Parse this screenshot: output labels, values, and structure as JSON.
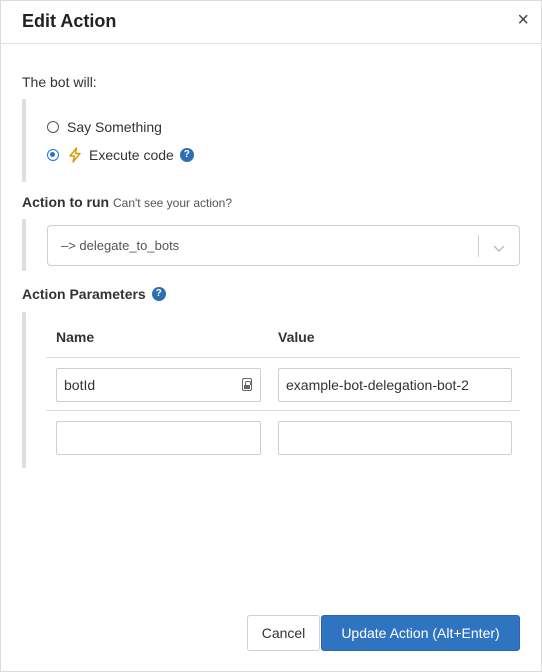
{
  "dialog": {
    "title": "Edit Action",
    "close_glyph": "×"
  },
  "bot_section": {
    "label": "The bot will:",
    "options": [
      {
        "label": "Say Something",
        "selected": false
      },
      {
        "label": "Execute code",
        "selected": true,
        "icon": "lightning-icon"
      }
    ]
  },
  "action_section": {
    "label": "Action to run",
    "hint": "Can't see your action?",
    "selected_value": "–> delegate_to_bots"
  },
  "params_section": {
    "label": "Action Parameters",
    "columns": {
      "name": "Name",
      "value": "Value"
    },
    "rows": [
      {
        "name": "botId",
        "value": "example-bot-delegation-bot-2"
      },
      {
        "name": "",
        "value": ""
      }
    ]
  },
  "buttons": {
    "cancel": "Cancel",
    "submit": "Update Action (Alt+Enter)"
  },
  "colors": {
    "primary": "#2f74c0",
    "help_icon": "#2e6fb0",
    "radio_selected": "#1f73d8",
    "lightning": "#f0a800"
  }
}
